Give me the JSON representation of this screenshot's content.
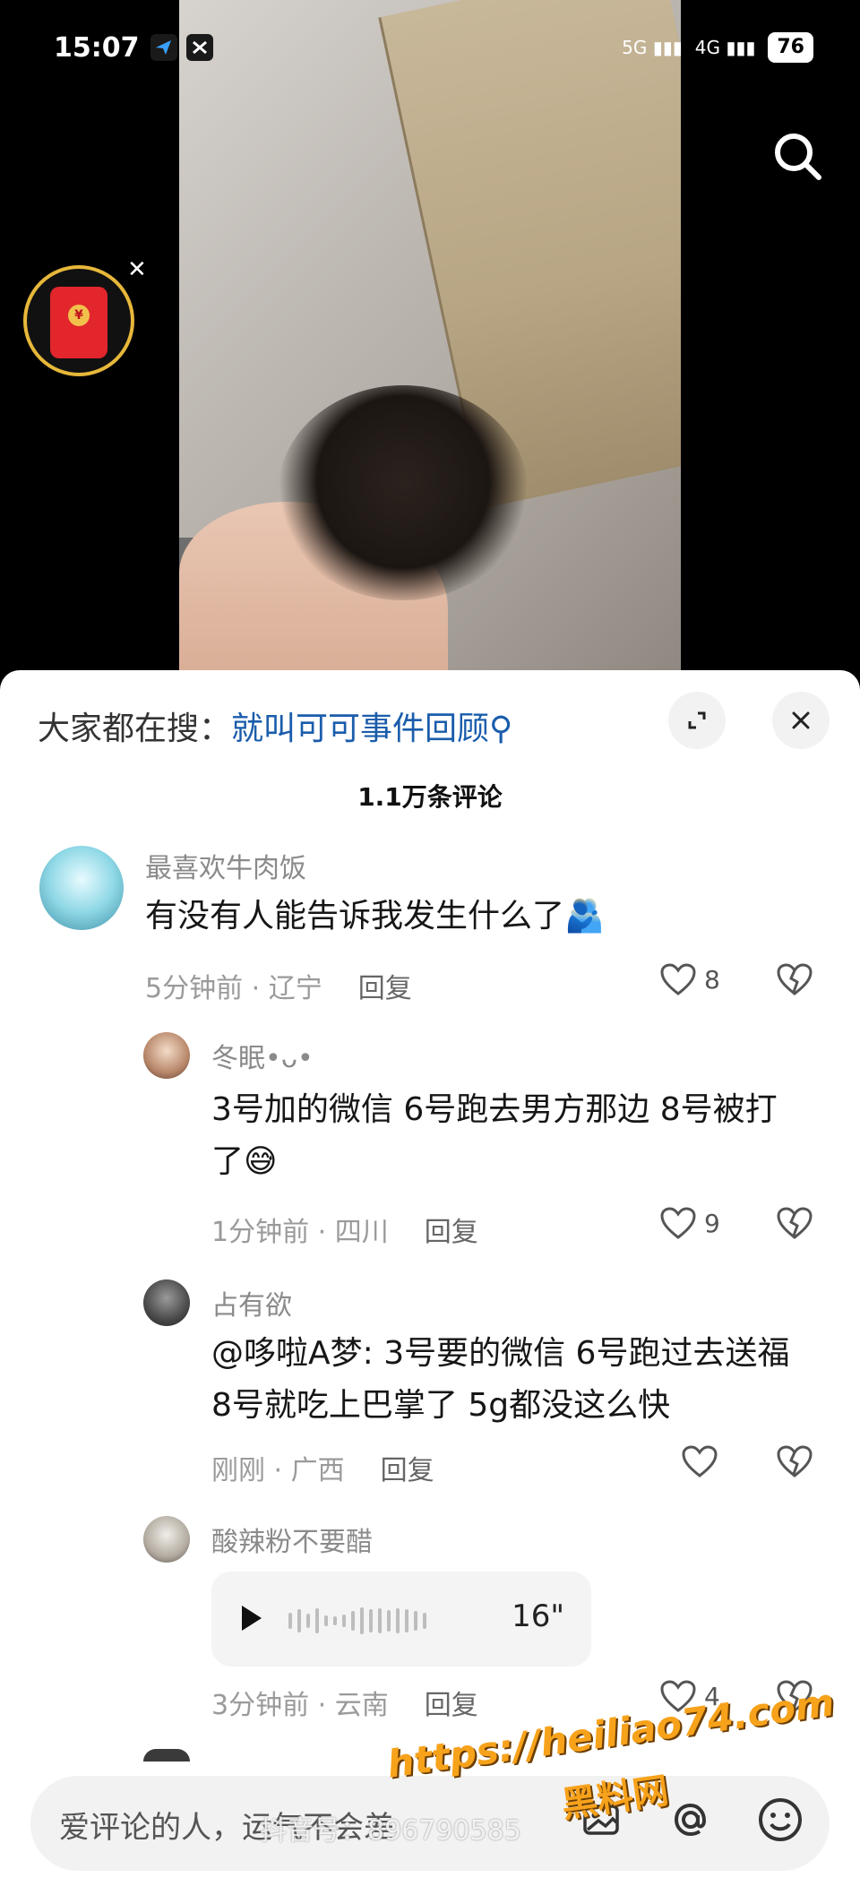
{
  "status_bar": {
    "time": "15:07",
    "signal_left": "5G",
    "signal_right": "4G",
    "battery": "76"
  },
  "comments_sheet": {
    "search_label": "大家都在搜：",
    "search_link": "就叫可可事件回顾",
    "comment_count": "1.1万条评论"
  },
  "comments": [
    {
      "name": "最喜欢牛肉饭",
      "text": "有没有人能告诉我发生什么了🫂",
      "time_place": "5分钟前 · 辽宁",
      "reply": "回复",
      "likes": "8"
    },
    {
      "name": "冬眠•ᴗ•",
      "text": "3号加的微信 6号跑去男方那边 8号被打了😅",
      "time_place": "1分钟前 · 四川",
      "reply": "回复",
      "likes": "9"
    },
    {
      "name": "占有欲",
      "text": "@哆啦A梦: 3号要的微信 6号跑过去送福  8号就吃上巴掌了 5g都没这么快",
      "time_place": "刚刚 · 广西",
      "reply": "回复",
      "likes": ""
    },
    {
      "name": "酸辣粉不要醋",
      "voice_duration": "16\"",
      "time_place": "3分钟前 · 云南",
      "reply": "回复",
      "likes": "4"
    }
  ],
  "input": {
    "placeholder": "爱评论的人，运气不会差"
  },
  "watermarks": {
    "douyin_id": "抖音号：896790585",
    "site_url": "https://heiliao74.com",
    "site_name": "黑料网"
  },
  "icons": [
    "search-icon",
    "red-packet-icon",
    "close-icon",
    "expand-icon",
    "heart-icon",
    "broken-heart-icon",
    "play-icon",
    "at-icon",
    "emoji-icon"
  ]
}
